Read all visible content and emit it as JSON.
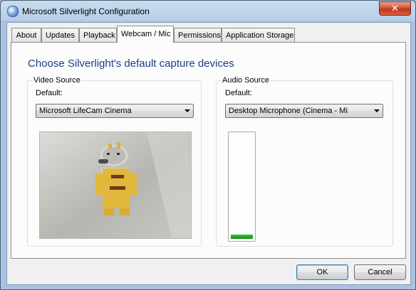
{
  "window": {
    "title": "Microsoft Silverlight Configuration",
    "close_label": "✕"
  },
  "tabs": [
    {
      "label": "About"
    },
    {
      "label": "Updates"
    },
    {
      "label": "Playback"
    },
    {
      "label": "Webcam / Mic",
      "active": true
    },
    {
      "label": "Permissions"
    },
    {
      "label": "Application Storage"
    }
  ],
  "panel": {
    "heading": "Choose Silverlight's default capture devices",
    "video": {
      "legend": "Video Source",
      "default_label": "Default:",
      "device": "Microsoft LifeCam Cinema"
    },
    "audio": {
      "legend": "Audio Source",
      "default_label": "Default:",
      "device": "Desktop Microphone (Cinema - Mi",
      "level_percent": 4
    }
  },
  "buttons": {
    "ok": "OK",
    "cancel": "Cancel"
  },
  "colors": {
    "heading": "#1d3c8c",
    "meter": "#0d8a0d"
  }
}
